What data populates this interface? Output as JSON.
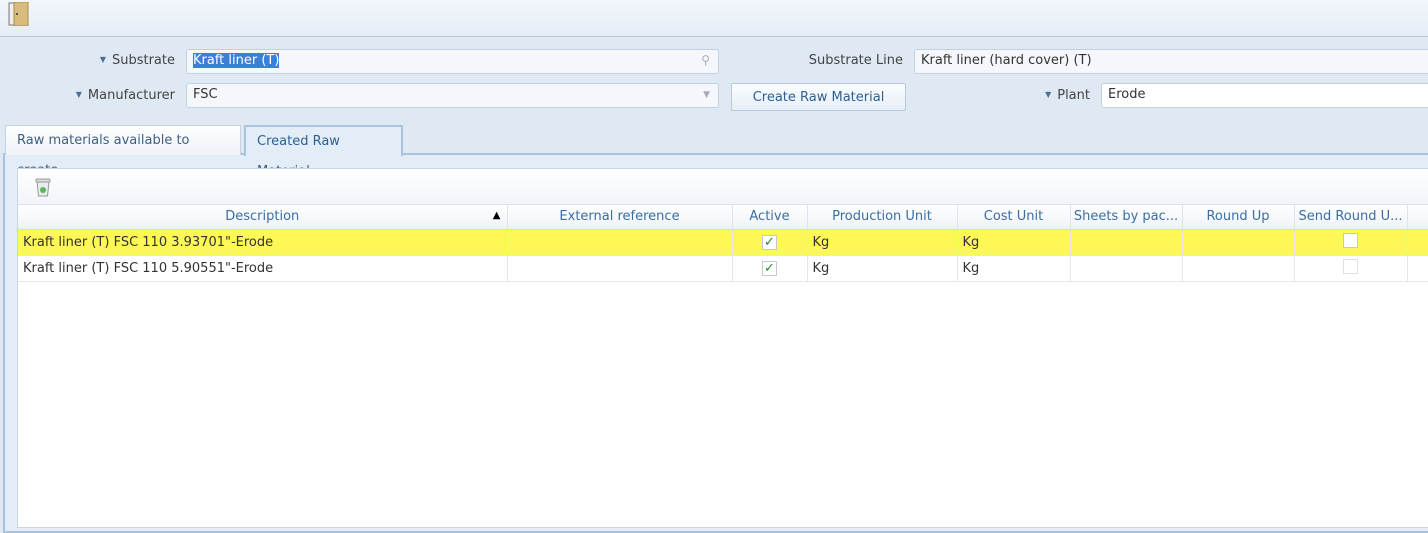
{
  "toolbar": {
    "icon": "door-exit-icon"
  },
  "form": {
    "substrate": {
      "label": "Substrate",
      "value": "Kraft liner (T)"
    },
    "manufacturer": {
      "label": "Manufacturer",
      "value": "FSC"
    },
    "substrate_line": {
      "label": "Substrate Line",
      "value": "Kraft liner (hard cover) (T)"
    },
    "plant": {
      "label": "Plant",
      "value": "Erode"
    },
    "create_button": "Create Raw Material"
  },
  "tabs": [
    {
      "label": "Raw materials available to create",
      "active": false
    },
    {
      "label": "Created Raw Material",
      "active": true
    }
  ],
  "grid": {
    "delete_icon": "recycle-bin-icon",
    "columns": [
      "Description",
      "External reference",
      "Active",
      "Production Unit",
      "Cost Unit",
      "Sheets by pac...",
      "Round Up",
      "Send Round U..."
    ],
    "sort": {
      "column": "Description",
      "direction": "ascending"
    },
    "rows": [
      {
        "description": "Kraft liner (T) FSC 110 3.93701\"-Erode",
        "external_reference": "",
        "active": true,
        "production_unit": "Kg",
        "cost_unit": "Kg",
        "sheets_by_pack": "",
        "round_up": "",
        "send_round_up": false,
        "highlighted": true
      },
      {
        "description": "Kraft liner (T) FSC 110 5.90551\"-Erode",
        "external_reference": "",
        "active": true,
        "production_unit": "Kg",
        "cost_unit": "Kg",
        "sheets_by_pack": "",
        "round_up": "",
        "send_round_up": false,
        "highlighted": false
      }
    ],
    "highlight_color": "#fdf855"
  }
}
